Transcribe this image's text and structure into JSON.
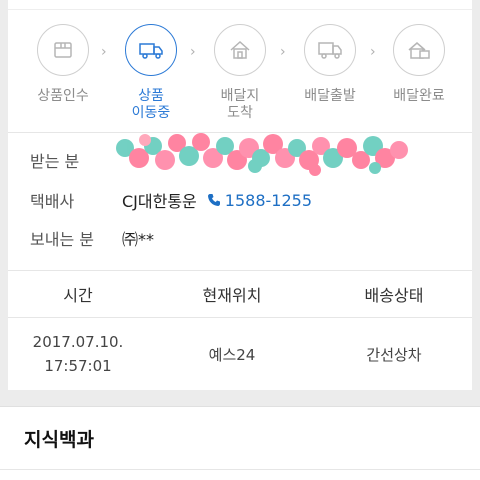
{
  "steps": [
    {
      "label": "상품인수",
      "icon": "box-icon",
      "active": false
    },
    {
      "label": "상품\n이동중",
      "icon": "truck-icon",
      "active": true
    },
    {
      "label": "배달지\n도착",
      "icon": "house-icon",
      "active": false
    },
    {
      "label": "배달출발",
      "icon": "delivery-truck-icon",
      "active": false
    },
    {
      "label": "배달완료",
      "icon": "delivered-icon",
      "active": false
    }
  ],
  "info": {
    "receiver_label": "받는 분",
    "courier_label": "택배사",
    "courier_name": "CJ대한통운",
    "courier_phone": "1588-1255",
    "sender_label": "보내는 분",
    "sender_name": "㈜**"
  },
  "table": {
    "headers": [
      "시간",
      "현재위치",
      "배송상태"
    ],
    "rows": [
      {
        "date": "2017.07.10.",
        "time": "17:57:01",
        "location": "예스24",
        "status": "간선상차"
      }
    ]
  },
  "section": {
    "title": "지식백과"
  },
  "colors": {
    "accent": "#2c7ad6",
    "phone": "#1e6fc4"
  }
}
